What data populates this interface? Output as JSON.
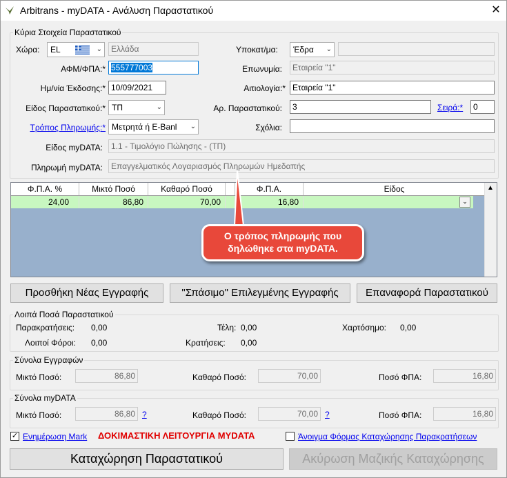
{
  "window": {
    "title": "Arbitrans - myDATA - Ανάλυση Παραστατικού",
    "close_glyph": "✕"
  },
  "main_info": {
    "legend": "Κύρια Στοιχεία Παραστατικού",
    "country_label": "Χώρα:",
    "country_code": "EL",
    "country_name": "Ελλάδα",
    "subsidiary_label": "Υποκατ/μα:",
    "subsidiary_value": "Έδρα",
    "subsidiary_extra": "",
    "vat_label": "ΑΦΜ/ΦΠΑ:*",
    "vat_value": "555777003",
    "company_label": "Επωνυμία:",
    "company_value": "Εταιρεία \"1\"",
    "issue_date_label": "Ημ/νία Έκδοσης:*",
    "issue_date_value": "10/09/2021",
    "reason_label": "Αιτιολογία:*",
    "reason_value": "Εταιρεία \"1\"",
    "doc_type_label": "Είδος Παραστατικού:*",
    "doc_type_value": "ΤΠ",
    "doc_number_label": "Αρ. Παραστατικού:",
    "doc_number_value": "3",
    "series_label": "Σειρά:*",
    "series_value": "0",
    "payment_method_label": "Τρόπος Πληρωμής:*",
    "payment_method_value": "Μετρητά ή E-Banl",
    "comments_label": "Σχόλια:",
    "comments_value": "",
    "mydata_type_label": "Είδος myDATA:",
    "mydata_type_value": "1.1 - Τιμολόγιο Πώλησης - (ΤΠ)",
    "mydata_payment_label": "Πληρωμή myDATA:",
    "mydata_payment_value": "Επαγγελματικός Λογαριασμός Πληρωμών Ημεδαπής"
  },
  "grid": {
    "columns": [
      "Φ.Π.Α. %",
      "Μικτό Ποσό",
      "Καθαρό Ποσό",
      "",
      "Φ.Π.Α.",
      "Είδος"
    ],
    "rows": [
      {
        "vat_pct": "24,00",
        "gross": "86,80",
        "net": "70,00",
        "vat": "16,80",
        "kind": ""
      }
    ]
  },
  "callout": {
    "line1": "Ο τρόπος πληρωμής που",
    "line2": "δηλώθηκε στα myDATA."
  },
  "actions": {
    "add_record": "Προσθήκη Νέας Εγγραφής",
    "split_record": "\"Σπάσιμο\" Επιλεγμένης Εγγραφής",
    "restore_doc": "Επαναφορά Παραστατικού"
  },
  "other_amounts": {
    "legend": "Λοιπά Ποσά Παραστατικού",
    "withholdings_label": "Παρακρατήσεις:",
    "withholdings_value": "0,00",
    "fees_label": "Τέλη:",
    "fees_value": "0,00",
    "stamp_label": "Χαρτόσημο:",
    "stamp_value": "0,00",
    "other_taxes_label": "Λοιποί Φόροι:",
    "other_taxes_value": "0,00",
    "deductions_label": "Κρατήσεις:",
    "deductions_value": "0,00"
  },
  "totals_records": {
    "legend": "Σύνολα Εγγραφών",
    "gross_label": "Μικτό Ποσό:",
    "gross_value": "86,80",
    "net_label": "Καθαρό Ποσό:",
    "net_value": "70,00",
    "vat_label": "Ποσό ΦΠΑ:",
    "vat_value": "16,80"
  },
  "totals_mydata": {
    "legend": "Σύνολα myDATA",
    "gross_label": "Μικτό Ποσό:",
    "gross_value": "86,80",
    "net_label": "Καθαρό Ποσό:",
    "net_value": "70,00",
    "vat_label": "Ποσό ΦΠΑ:",
    "vat_value": "16,80",
    "help_link": "?"
  },
  "footer": {
    "update_mark_label": "Ενημέρωση Mark",
    "test_mode_text": "ΔΟΚΙΜΑΣΤΙΚΗ ΛΕΙΤΟΥΡΓΙΑ MYDATA",
    "open_form_label": "Άνοιγμα Φόρμας Καταχώρησης Παρακρατήσεων",
    "save_button": "Καταχώρηση Παραστατικού",
    "cancel_bulk_button": "Ακύρωση Μαζικής Καταχώρησης"
  },
  "colors": {
    "accent": "#0078d7",
    "link": "#0000ee",
    "warning": "#e00000",
    "grid_bg": "#98b0cc",
    "row_bg": "#c8f7c0",
    "callout": "#e8483a"
  },
  "icons": [
    "app-bird-icon",
    "close-icon",
    "greek-flag-icon",
    "chevron-down-icon",
    "checkbox-checked-icon"
  ]
}
